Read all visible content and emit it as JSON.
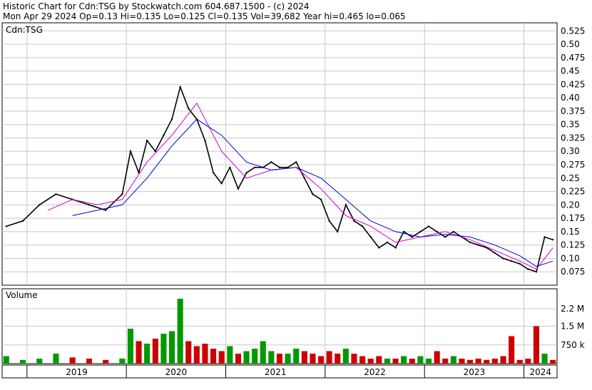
{
  "header": {
    "line1": "Historic Chart for Cdn:TSG by Stockwatch.com 604.687.1500 - (c) 2024",
    "line2": "Mon Apr 29 2024  Op=0.13  Hi=0.135  Lo=0.125  Cl=0.135  Vol=39,682  Year hi=0.465  lo=0.065"
  },
  "chart_data": [
    {
      "type": "line",
      "title": "Cdn:TSG",
      "ylim": [
        0.05,
        0.54
      ],
      "y_ticks": [
        "0.525",
        "0.50",
        "0.475",
        "0.45",
        "0.425",
        "0.40",
        "0.375",
        "0.35",
        "0.325",
        "0.30",
        "0.275",
        "0.25",
        "0.225",
        "0.20",
        "0.175",
        "0.15",
        "0.125",
        "0.10",
        "0.075"
      ],
      "x_ticks": [
        "2019",
        "2020",
        "2021",
        "2022",
        "2023",
        "2024"
      ],
      "grid": true,
      "colors": {
        "price": "#000000",
        "ma_short": "#cc00cc",
        "ma_long": "#0000cc",
        "up": "#cc0000",
        "down": "#009900"
      },
      "series": [
        {
          "name": "Price",
          "x": [
            "2018-10",
            "2018-12",
            "2019-02",
            "2019-04",
            "2019-06",
            "2019-08",
            "2019-10",
            "2019-12",
            "2020-01",
            "2020-02",
            "2020-03",
            "2020-04",
            "2020-05",
            "2020-06",
            "2020-07",
            "2020-08",
            "2020-09",
            "2020-10",
            "2020-11",
            "2020-12",
            "2021-01",
            "2021-02",
            "2021-03",
            "2021-04",
            "2021-05",
            "2021-06",
            "2021-07",
            "2021-08",
            "2021-09",
            "2021-10",
            "2021-11",
            "2021-12",
            "2022-01",
            "2022-02",
            "2022-03",
            "2022-04",
            "2022-05",
            "2022-06",
            "2022-07",
            "2022-08",
            "2022-09",
            "2022-10",
            "2022-11",
            "2022-12",
            "2023-01",
            "2023-02",
            "2023-03",
            "2023-04",
            "2023-05",
            "2023-06",
            "2023-07",
            "2023-08",
            "2023-09",
            "2023-10",
            "2023-11",
            "2023-12",
            "2024-01",
            "2024-02",
            "2024-03",
            "2024-04"
          ],
          "values": [
            0.16,
            0.17,
            0.2,
            0.22,
            0.21,
            0.2,
            0.19,
            0.22,
            0.3,
            0.26,
            0.32,
            0.3,
            0.33,
            0.36,
            0.42,
            0.38,
            0.36,
            0.32,
            0.26,
            0.24,
            0.27,
            0.23,
            0.26,
            0.27,
            0.27,
            0.28,
            0.27,
            0.27,
            0.28,
            0.25,
            0.22,
            0.21,
            0.17,
            0.15,
            0.2,
            0.17,
            0.16,
            0.14,
            0.12,
            0.13,
            0.12,
            0.15,
            0.14,
            0.15,
            0.16,
            0.15,
            0.14,
            0.15,
            0.14,
            0.13,
            0.125,
            0.12,
            0.11,
            0.1,
            0.095,
            0.09,
            0.08,
            0.075,
            0.14,
            0.135
          ]
        },
        {
          "name": "MA short",
          "x": [
            "2019-03",
            "2019-06",
            "2019-09",
            "2019-12",
            "2020-03",
            "2020-06",
            "2020-09",
            "2020-12",
            "2021-03",
            "2021-06",
            "2021-09",
            "2021-12",
            "2022-03",
            "2022-06",
            "2022-09",
            "2022-12",
            "2023-03",
            "2023-06",
            "2023-09",
            "2023-12",
            "2024-02",
            "2024-04"
          ],
          "values": [
            0.19,
            0.21,
            0.2,
            0.21,
            0.28,
            0.33,
            0.39,
            0.3,
            0.25,
            0.265,
            0.27,
            0.23,
            0.18,
            0.16,
            0.13,
            0.14,
            0.15,
            0.135,
            0.115,
            0.095,
            0.08,
            0.12
          ]
        },
        {
          "name": "MA long",
          "x": [
            "2019-06",
            "2019-09",
            "2019-12",
            "2020-03",
            "2020-06",
            "2020-09",
            "2020-12",
            "2021-03",
            "2021-06",
            "2021-09",
            "2021-12",
            "2022-03",
            "2022-06",
            "2022-09",
            "2022-12",
            "2023-03",
            "2023-06",
            "2023-09",
            "2023-12",
            "2024-02",
            "2024-04"
          ],
          "values": [
            0.18,
            0.19,
            0.2,
            0.25,
            0.31,
            0.36,
            0.33,
            0.28,
            0.265,
            0.27,
            0.25,
            0.21,
            0.17,
            0.15,
            0.14,
            0.145,
            0.14,
            0.125,
            0.105,
            0.085,
            0.095
          ]
        }
      ]
    },
    {
      "type": "bar",
      "title": "Volume",
      "ylim": [
        0,
        3000000
      ],
      "y_ticks": [
        "2.2 M",
        "1.5 M",
        "750 k"
      ],
      "x": [
        "2018-10",
        "2018-12",
        "2019-02",
        "2019-04",
        "2019-06",
        "2019-08",
        "2019-10",
        "2019-12",
        "2020-01",
        "2020-02",
        "2020-03",
        "2020-04",
        "2020-05",
        "2020-06",
        "2020-07",
        "2020-08",
        "2020-09",
        "2020-10",
        "2020-11",
        "2020-12",
        "2021-01",
        "2021-02",
        "2021-03",
        "2021-04",
        "2021-05",
        "2021-06",
        "2021-07",
        "2021-08",
        "2021-09",
        "2021-10",
        "2021-11",
        "2021-12",
        "2022-01",
        "2022-02",
        "2022-03",
        "2022-04",
        "2022-05",
        "2022-06",
        "2022-07",
        "2022-08",
        "2022-09",
        "2022-10",
        "2022-11",
        "2022-12",
        "2023-01",
        "2023-02",
        "2023-03",
        "2023-04",
        "2023-05",
        "2023-06",
        "2023-07",
        "2023-08",
        "2023-09",
        "2023-10",
        "2023-11",
        "2023-12",
        "2024-01",
        "2024-02",
        "2024-03",
        "2024-04"
      ],
      "values": [
        300000,
        150000,
        200000,
        400000,
        250000,
        200000,
        150000,
        200000,
        1400000,
        900000,
        800000,
        1000000,
        1200000,
        1300000,
        2600000,
        900000,
        700000,
        800000,
        600000,
        500000,
        700000,
        400000,
        500000,
        600000,
        900000,
        500000,
        400000,
        400000,
        600000,
        500000,
        400000,
        300000,
        500000,
        400000,
        600000,
        400000,
        300000,
        200000,
        300000,
        200000,
        200000,
        300000,
        200000,
        300000,
        200000,
        500000,
        200000,
        300000,
        200000,
        150000,
        200000,
        150000,
        200000,
        300000,
        1100000,
        150000,
        200000,
        1500000,
        400000,
        150000
      ],
      "volume_ticks": [
        2200000,
        1500000,
        750000
      ]
    }
  ]
}
